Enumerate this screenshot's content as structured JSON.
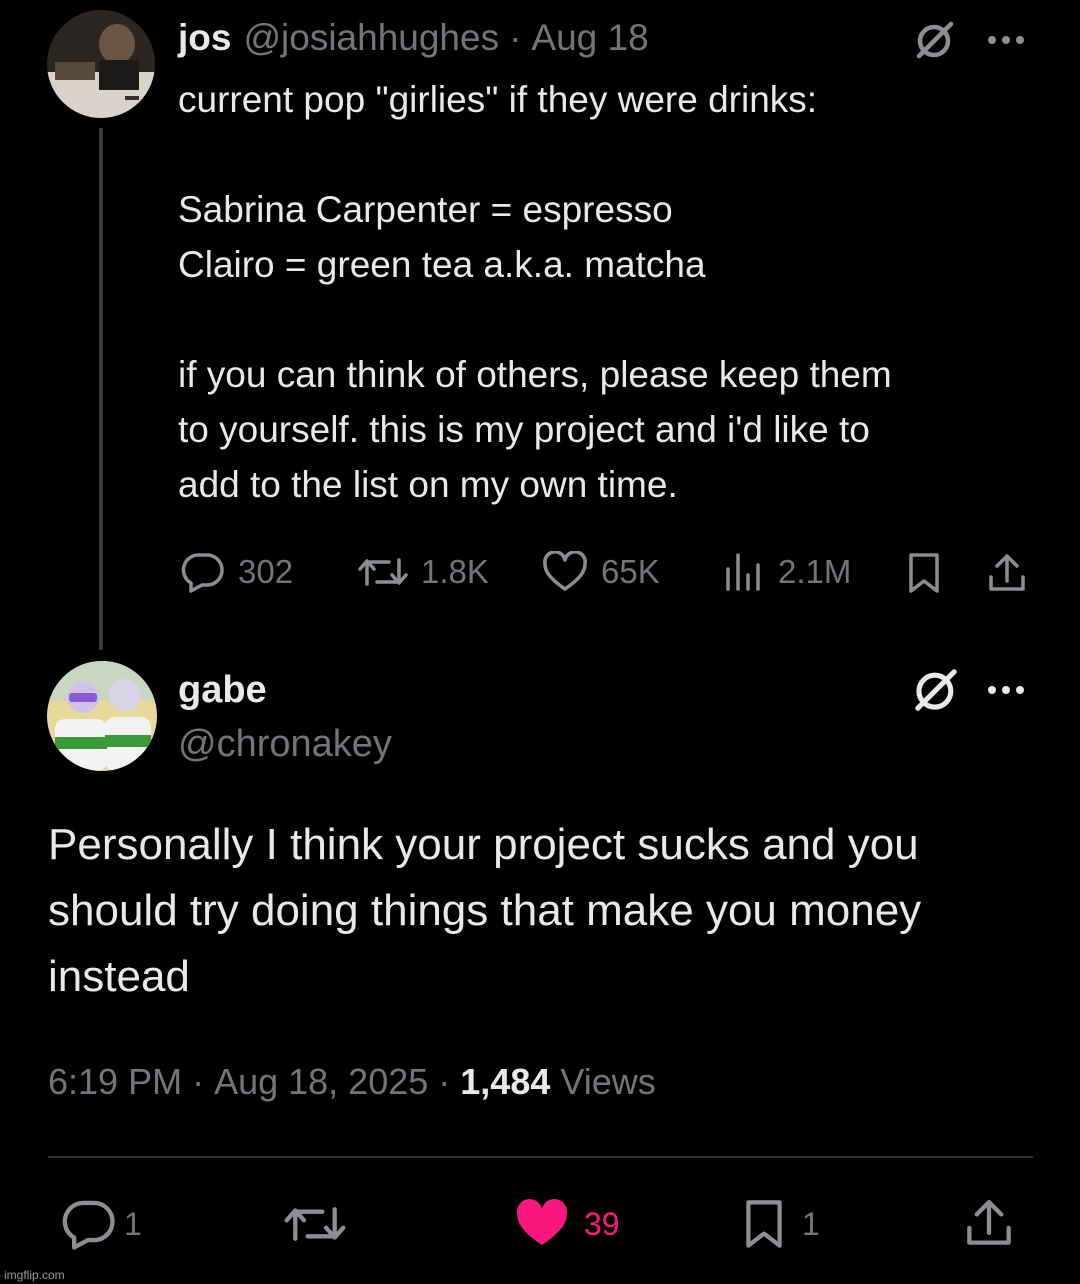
{
  "parent_tweet": {
    "display_name": "jos",
    "handle": "@josiahhughes",
    "separator": "·",
    "date": "Aug 18",
    "body": "current pop \"girlies\" if they were drinks:\n\nSabrina Carpenter = espresso\nClairo = green tea a.k.a. matcha\n\nif you can think of others, please keep them\nto yourself. this is my project and i'd like to\nadd to the list on my own time.",
    "stats": {
      "replies": "302",
      "reposts": "1.8K",
      "likes": "65K",
      "views": "2.1M"
    }
  },
  "reply_tweet": {
    "display_name": "gabe",
    "handle": "@chronakey",
    "body": "Personally I think your project sucks and you\nshould try doing things that make you money\ninstead",
    "time": "6:19 PM",
    "separator1": "·",
    "date": "Aug 18, 2025",
    "separator2": "·",
    "views_count": "1,484",
    "views_label": "Views",
    "actions": {
      "replies": "1",
      "likes": "39",
      "bookmarks": "1"
    }
  },
  "watermark": "imgflip.com",
  "colors": {
    "background": "#000000",
    "text": "#e7e9ea",
    "muted": "#71767b",
    "like_active": "#f91880",
    "divider": "#2f3336"
  },
  "icons": [
    "grok-icon",
    "more-icon",
    "reply-icon",
    "repost-icon",
    "like-icon",
    "views-icon",
    "bookmark-icon",
    "share-icon"
  ]
}
